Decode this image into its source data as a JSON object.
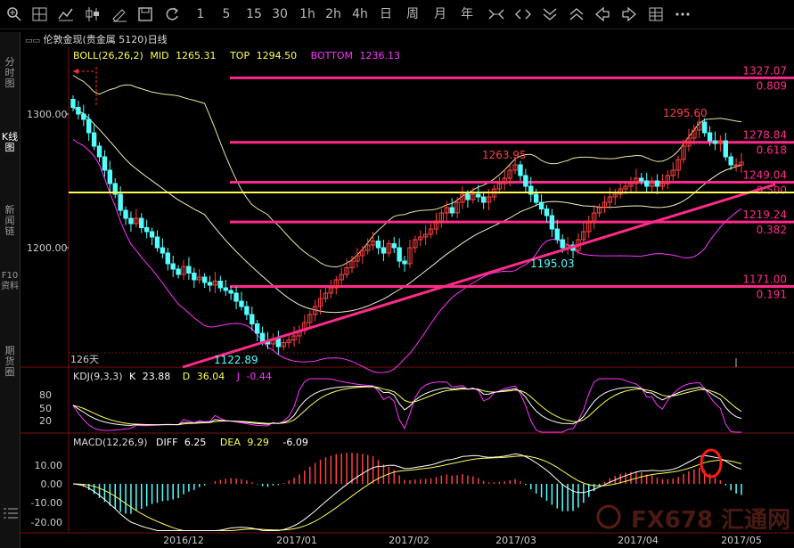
{
  "toolbar": {
    "periods": [
      "1",
      "5",
      "15",
      "30",
      "1h",
      "2h",
      "4h",
      "日",
      "周",
      "月",
      "年"
    ]
  },
  "sidebar": {
    "tabs": [
      {
        "label": "分时图",
        "active": false
      },
      {
        "label": "K线图",
        "active": true
      },
      {
        "label": "新闻链",
        "active": false
      },
      {
        "label": "F10资料",
        "active": false
      },
      {
        "label": "期货圈",
        "active": false
      }
    ]
  },
  "chart_title": "伦敦金现(贵金属 5120)日线",
  "boll": {
    "name": "BOLL(26,26,2)",
    "mid_label": "MID",
    "mid": "1265.31",
    "top_label": "TOP",
    "top": "1294.50",
    "bottom_label": "BOTTOM",
    "bottom": "1236.13"
  },
  "kdj": {
    "name": "KDJ(9,3,3)",
    "k_label": "K",
    "k": "23.88",
    "d_label": "D",
    "d": "36.04",
    "j_label": "J",
    "j": "-0.44"
  },
  "macd": {
    "name": "MACD(12,26,9)",
    "diff_label": "DIFF",
    "diff": "6.25",
    "dea_label": "DEA",
    "dea": "9.29",
    "macd": "-6.09"
  },
  "price_axis": [
    "1300.00",
    "1200.00"
  ],
  "kdj_axis": [
    "80",
    "50",
    "20"
  ],
  "macd_axis": [
    "10.00",
    "0.00",
    "-10.00",
    "-20.00"
  ],
  "date_axis": [
    "2016/12",
    "2017/01",
    "2017/02",
    "2017/03",
    "2017/04",
    "2017/05"
  ],
  "days_label": "126天",
  "annotations": {
    "low1": "1122.89",
    "low2": "1195.03",
    "high1": "1263.95",
    "high2": "1295.60"
  },
  "fib_levels": [
    {
      "price": "1327.07",
      "ratio": "0.809"
    },
    {
      "price": "1278.84",
      "ratio": "0.618"
    },
    {
      "price": "1249.04",
      "ratio": "0.500"
    },
    {
      "price": "1219.24",
      "ratio": "0.382"
    },
    {
      "price": "1171.00",
      "ratio": "0.191"
    }
  ],
  "watermark": "FX678 汇通网",
  "colors": {
    "up": "#ff4040",
    "down": "#54ffff",
    "fib": "#ff2a8a",
    "yellow": "#ffff55",
    "magenta": "#ff33ff"
  },
  "chart_data": {
    "type": "candlestick",
    "title": "伦敦金现(贵金属 5120)日线",
    "xlabel": "",
    "ylabel": "",
    "x_range": [
      "2016/11",
      "2017/05"
    ],
    "y_range": [
      1100,
      1345
    ],
    "annotated_prices": {
      "low_dec": 1122.89,
      "high_feb": 1263.95,
      "low_mar": 1195.03,
      "high_apr": 1295.6
    },
    "fib_retracement": [
      1327.07,
      1278.84,
      1249.04,
      1219.24,
      1171.0
    ],
    "boll_latest": {
      "mid": 1265.31,
      "top": 1294.5,
      "bottom": 1236.13
    },
    "kdj_latest": {
      "K": 23.88,
      "D": 36.04,
      "J": -0.44
    },
    "macd_latest": {
      "DIFF": 6.25,
      "DEA": 9.29,
      "MACD": -6.09
    },
    "closes": [
      1305,
      1300,
      1296,
      1286,
      1276,
      1268,
      1258,
      1248,
      1240,
      1228,
      1222,
      1218,
      1222,
      1215,
      1212,
      1208,
      1200,
      1196,
      1188,
      1184,
      1180,
      1186,
      1181,
      1176,
      1178,
      1174,
      1172,
      1175,
      1170,
      1168,
      1166,
      1160,
      1156,
      1150,
      1143,
      1136,
      1130,
      1128,
      1132,
      1126,
      1129,
      1131,
      1134,
      1138,
      1144,
      1150,
      1156,
      1162,
      1166,
      1170,
      1176,
      1180,
      1185,
      1190,
      1194,
      1198,
      1202,
      1205,
      1200,
      1196,
      1203,
      1200,
      1190,
      1188,
      1200,
      1206,
      1208,
      1210,
      1214,
      1220,
      1226,
      1230,
      1226,
      1234,
      1240,
      1236,
      1240,
      1238,
      1234,
      1238,
      1244,
      1248,
      1252,
      1258,
      1262,
      1254,
      1246,
      1240,
      1234,
      1229,
      1224,
      1214,
      1206,
      1200,
      1202,
      1198,
      1206,
      1212,
      1220,
      1226,
      1230,
      1234,
      1238,
      1240,
      1244,
      1246,
      1248,
      1252,
      1250,
      1246,
      1250,
      1246,
      1248,
      1254,
      1258,
      1266,
      1276,
      1282,
      1288,
      1294,
      1286,
      1280,
      1278,
      1280,
      1268,
      1262,
      1262,
      1264
    ]
  }
}
